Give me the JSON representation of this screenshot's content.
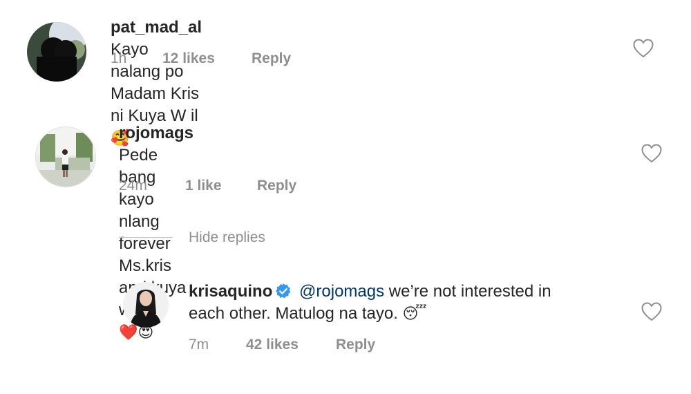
{
  "comments": [
    {
      "username": "pat_mad_al",
      "text": "Kayo nalang po Madam Kris ni Kuya W il",
      "emoji": "🥰",
      "time": "1h",
      "likes": "12 likes",
      "reply": "Reply"
    },
    {
      "username": "rojomags",
      "text_line1": "Pede bang kayo nlang forever Ms.kris and kuya wil",
      "emoji_line2": "❤️😍",
      "time": "24m",
      "likes": "1 like",
      "reply": "Reply"
    }
  ],
  "replies_toggle": {
    "label": "Hide replies"
  },
  "reply_comment": {
    "username": "krisaquino",
    "mention": "@rojomags",
    "text_line1": " we’re not interested in",
    "text_line2": "each other. Matulog na tayo. ",
    "emoji": "😴",
    "time": "7m",
    "likes": "42 likes",
    "reply": "Reply"
  },
  "colors": {
    "username": "#262626",
    "meta": "#8e8e8e",
    "mention": "#00376b",
    "verified": "#3897f0"
  }
}
